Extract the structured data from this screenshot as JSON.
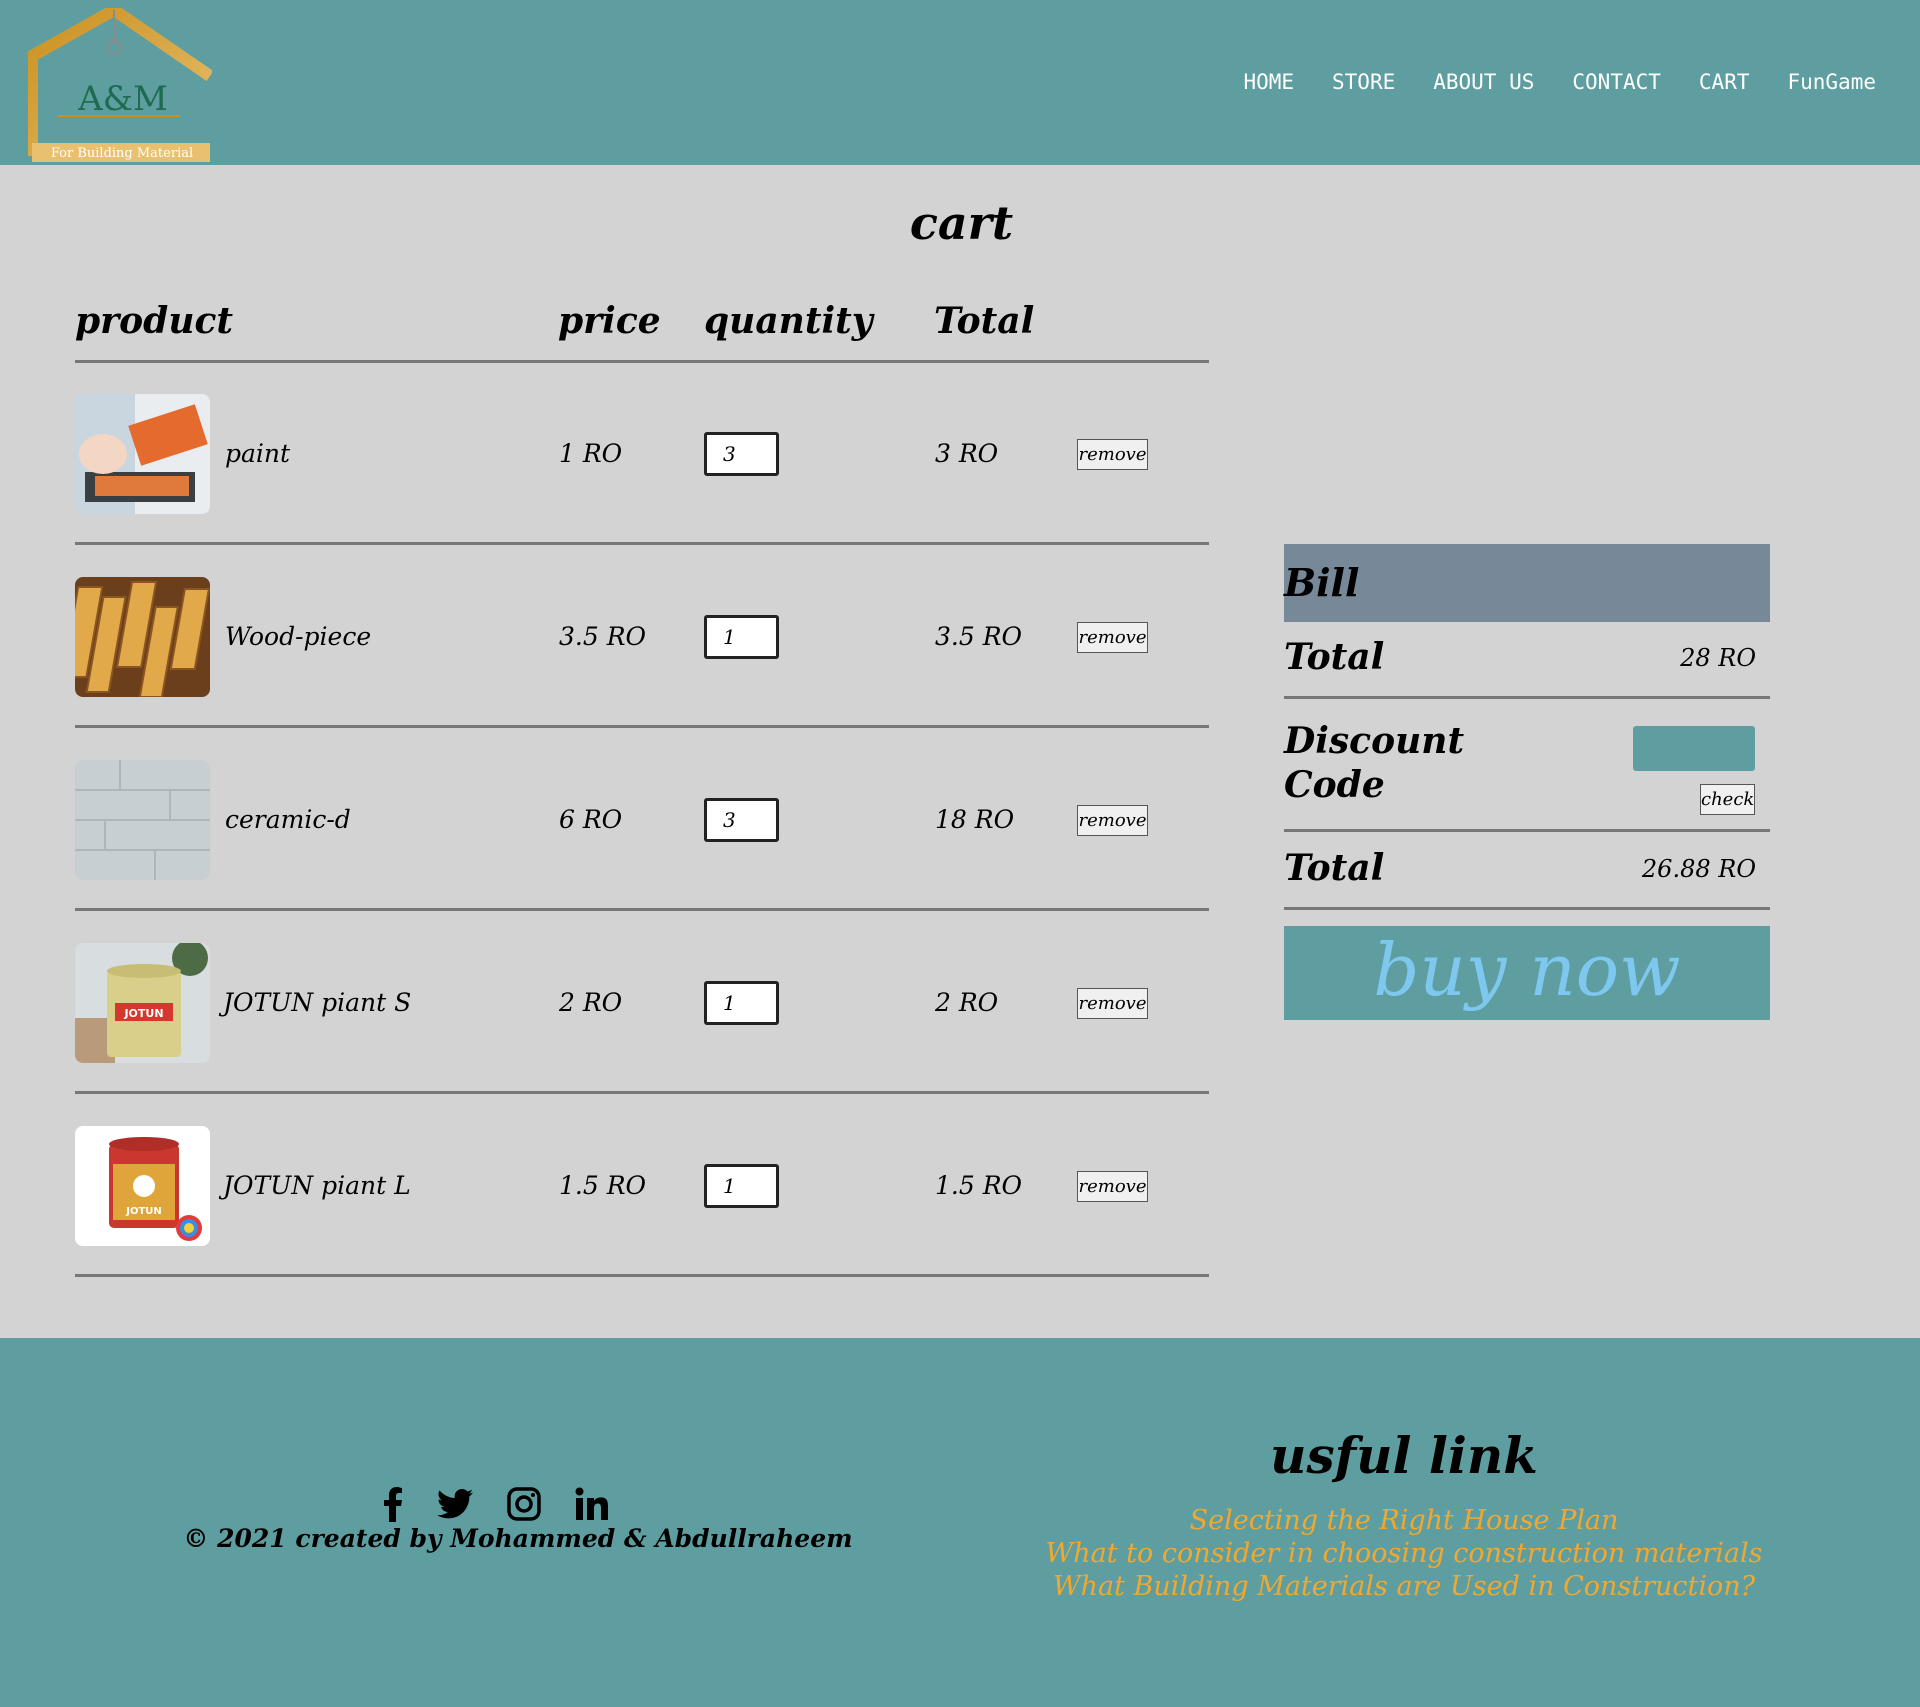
{
  "brand": {
    "logo_text": "A&M",
    "logo_sub": "For Building Material"
  },
  "nav": [
    {
      "label": "HOME"
    },
    {
      "label": "STORE"
    },
    {
      "label": "ABOUT US"
    },
    {
      "label": "CONTACT"
    },
    {
      "label": "CART"
    },
    {
      "label": "FunGame"
    }
  ],
  "cart": {
    "title": "cart",
    "headers": {
      "product": "product",
      "price": "price",
      "quantity": "quantity",
      "total": "Total"
    },
    "remove_label": "remove",
    "items": [
      {
        "name": "paint",
        "price": "1 RO",
        "qty": "3",
        "total": "3 RO",
        "image": "paint-roller-image"
      },
      {
        "name": "Wood-piece",
        "price": "3.5 RO",
        "qty": "1",
        "total": "3.5 RO",
        "image": "wood-planks-image"
      },
      {
        "name": "ceramic-d",
        "price": "6 RO",
        "qty": "3",
        "total": "18 RO",
        "image": "ceramic-tile-image"
      },
      {
        "name": "JOTUN piant S",
        "price": "2 RO",
        "qty": "1",
        "total": "2 RO",
        "image": "jotun-can-small-image"
      },
      {
        "name": "JOTUN piant L",
        "price": "1.5 RO",
        "qty": "1",
        "total": "1.5 RO",
        "image": "jotun-can-large-image"
      }
    ]
  },
  "bill": {
    "title": "Bill",
    "total_label": "Total",
    "total_value": "28 RO",
    "discount_label_1": "Discount",
    "discount_label_2": "Code",
    "check_label": "check",
    "final_total_label": "Total",
    "final_total_value": "26.88 RO",
    "buy_label": "buy now"
  },
  "footer": {
    "social": [
      "facebook-icon",
      "twitter-icon",
      "instagram-icon",
      "linkedin-icon"
    ],
    "copyright": "© 2021 created by Mohammed & Abdullraheem",
    "links_title": "usful link",
    "links": [
      "Selecting the Right House Plan",
      "What to consider in choosing construction materials",
      "What Building Materials are Used in Construction?"
    ]
  },
  "colors": {
    "teal": "#5f9ea0",
    "bill_header": "#778899",
    "link_orange": "#f0a830",
    "buy_text": "#7ec8ef",
    "page_bg": "#d3d3d3"
  }
}
